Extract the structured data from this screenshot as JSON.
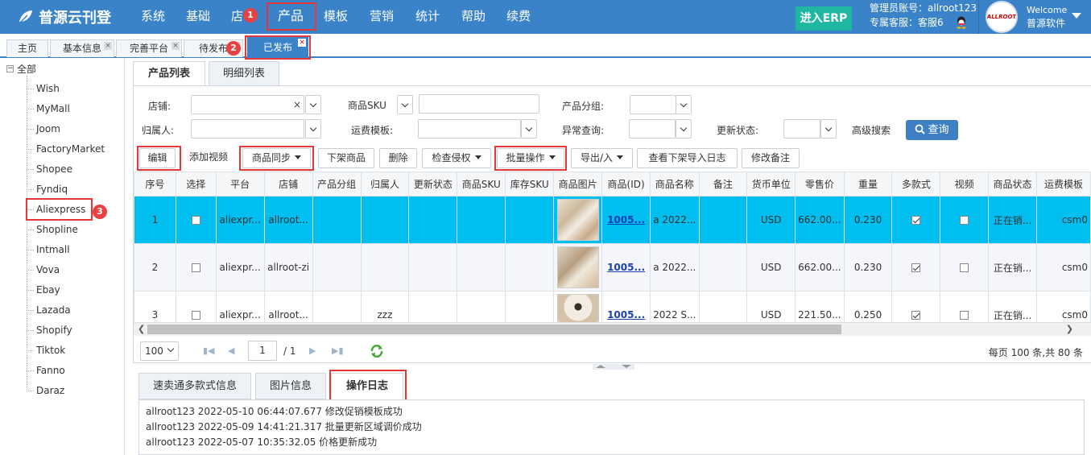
{
  "app": {
    "logo_text": "普源云刊登",
    "nav": [
      "系统",
      "基础",
      "店",
      "产品",
      "模板",
      "营销",
      "统计",
      "帮助",
      "续费"
    ],
    "erp_button": "进入ERP",
    "admin_line": "管理员账号：allroot123",
    "service_line": "专属客服：客服6",
    "welcome": "Welcome",
    "company": "普源软件",
    "avatar_logo": "ALLROOT"
  },
  "tabs": [
    "主页",
    "基本信息",
    "完善平台",
    "待发布",
    "已发布"
  ],
  "badges": [
    "1",
    "2",
    "3"
  ],
  "tree": {
    "toggle": "−",
    "root": "全部",
    "items": [
      "Wish",
      "MyMall",
      "Joom",
      "FactoryMarket",
      "Shopee",
      "Fyndiq",
      "Aliexpress",
      "Shopline",
      "Intmall",
      "Vova",
      "Ebay",
      "Lazada",
      "Shopify",
      "Tiktok",
      "Fanno",
      "Daraz"
    ]
  },
  "subtabs": [
    "产品列表",
    "明细列表"
  ],
  "filters": {
    "shop": "店铺:",
    "sku": "商品SKU",
    "group": "产品分组:",
    "owner": "归属人:",
    "freight": "运费模板:",
    "exception": "异常查询:",
    "update_status": "更新状态:",
    "advanced": "高级搜索",
    "search_btn": "查询",
    "clear": "×"
  },
  "toolbar": [
    "编辑",
    "添加视频",
    "商品同步",
    "下架商品",
    "删除",
    "检查侵权",
    "批量操作",
    "导出/入",
    "查看下架导入日志",
    "修改备注"
  ],
  "table": {
    "headers": [
      "序号",
      "选择",
      "平台",
      "店铺",
      "产品分组",
      "归属人",
      "更新状态",
      "商品SKU",
      "库存SKU",
      "商品图片",
      "商品(ID)",
      "商品名称",
      "备注",
      "货币单位",
      "零售价",
      "重量",
      "多款式",
      "视频",
      "商品状态",
      "运费模板"
    ],
    "rows": [
      {
        "no": "1",
        "platform": "aliexpr...",
        "shop": "allroot...",
        "group": "",
        "owner": "",
        "update": "",
        "sku": "",
        "stock_sku": "",
        "id": "1005...",
        "name": "a 2022...",
        "remark": "",
        "currency": "USD",
        "price": "662.00...",
        "weight": "0.230",
        "status": "正在销...",
        "freight": "csm0"
      },
      {
        "no": "2",
        "platform": "aliexpr...",
        "shop": "allroot-zi",
        "group": "",
        "owner": "",
        "update": "",
        "sku": "",
        "stock_sku": "",
        "id": "1005...",
        "name": "a 2022...",
        "remark": "",
        "currency": "USD",
        "price": "662.00...",
        "weight": "0.230",
        "status": "正在销...",
        "freight": "csm0"
      },
      {
        "no": "3",
        "platform": "aliexpr...",
        "shop": "allroot...",
        "group": "",
        "owner": "zzz",
        "update": "",
        "sku": "",
        "stock_sku": "",
        "id": "1005...",
        "name": "2022 S...",
        "remark": "",
        "currency": "USD",
        "price": "221.50...",
        "weight": "0.250",
        "status": "正在销...",
        "freight": "csm0"
      }
    ]
  },
  "pager": {
    "page_size": "100",
    "page": "1",
    "total_pages": "/ 1",
    "summary": "每页 100 条,共 80 条"
  },
  "bottom_tabs": [
    "速卖通多款式信息",
    "图片信息",
    "操作日志"
  ],
  "logs": [
    "allroot123 2022-05-10 06:44:07.677 修改促销模板成功",
    "allroot123 2022-05-09 14:41:21.317 批量更新区域调价成功",
    "allroot123 2022-05-07 10:35:32.05 价格更新成功"
  ],
  "colors": {
    "nav_bg": "#3a83c9",
    "erp_bg": "#1fb7a1",
    "selected_row": "#00bef0",
    "highlight": "#e43838"
  }
}
